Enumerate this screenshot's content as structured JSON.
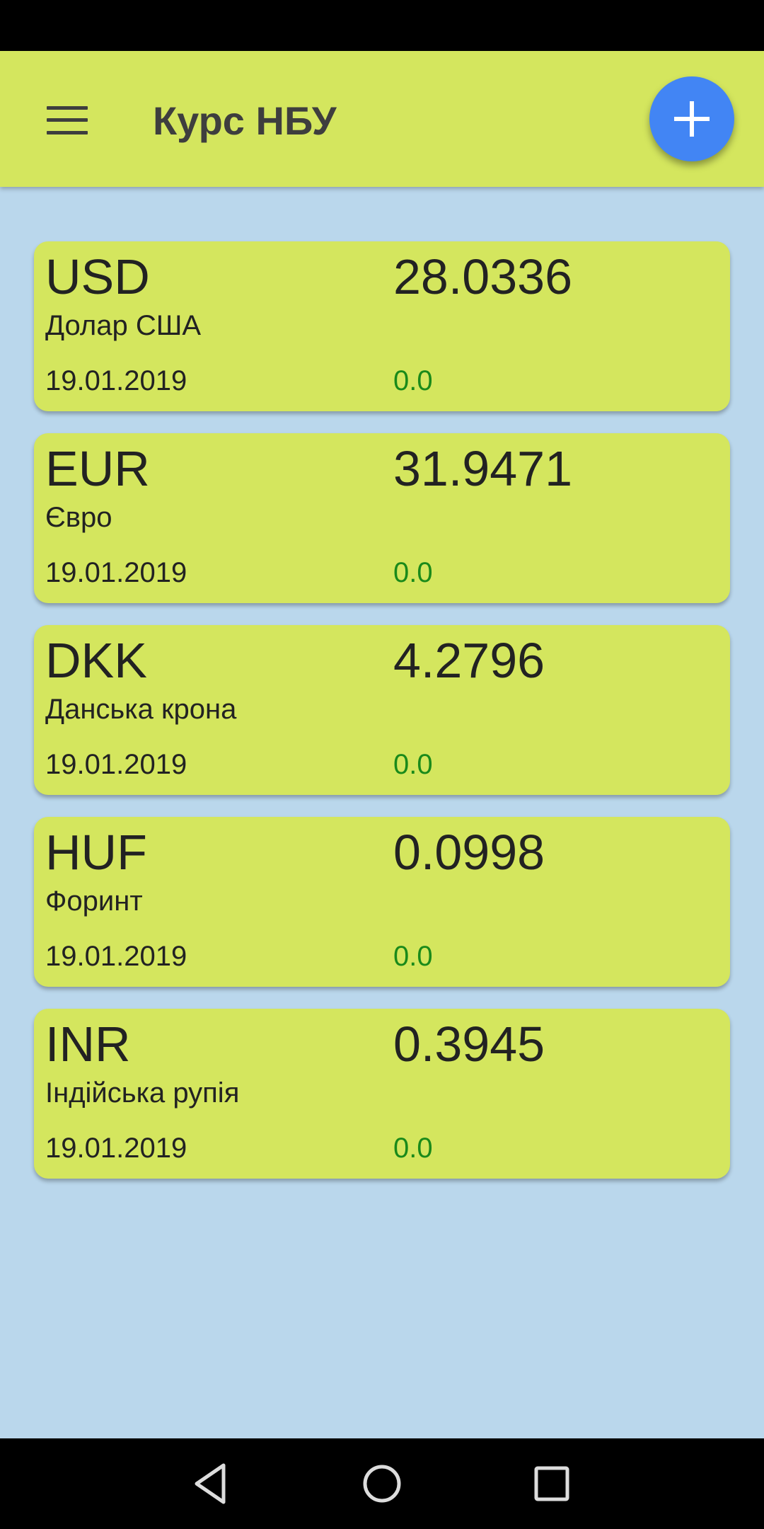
{
  "app_bar": {
    "title": "Курс НБУ",
    "background": "#d4e65e",
    "fab_color": "#4285f4",
    "menu_icon": "menu-icon",
    "add_icon": "plus-icon"
  },
  "colors": {
    "content_background": "#bad7ec",
    "card_background": "#d4e65e",
    "change_color": "#1a8a1a"
  },
  "currencies": [
    {
      "code": "USD",
      "rate": "28.0336",
      "name": "Долар США",
      "date": "19.01.2019",
      "change": "0.0"
    },
    {
      "code": "EUR",
      "rate": "31.9471",
      "name": "Євро",
      "date": "19.01.2019",
      "change": "0.0"
    },
    {
      "code": "DKK",
      "rate": "4.2796",
      "name": "Данська крона",
      "date": "19.01.2019",
      "change": "0.0"
    },
    {
      "code": "HUF",
      "rate": "0.0998",
      "name": "Форинт",
      "date": "19.01.2019",
      "change": "0.0"
    },
    {
      "code": "INR",
      "rate": "0.3945",
      "name": "Індійська рупія",
      "date": "19.01.2019",
      "change": "0.0"
    }
  ],
  "nav_bar": {
    "back_icon": "back-triangle-icon",
    "home_icon": "home-circle-icon",
    "recents_icon": "recents-square-icon"
  }
}
